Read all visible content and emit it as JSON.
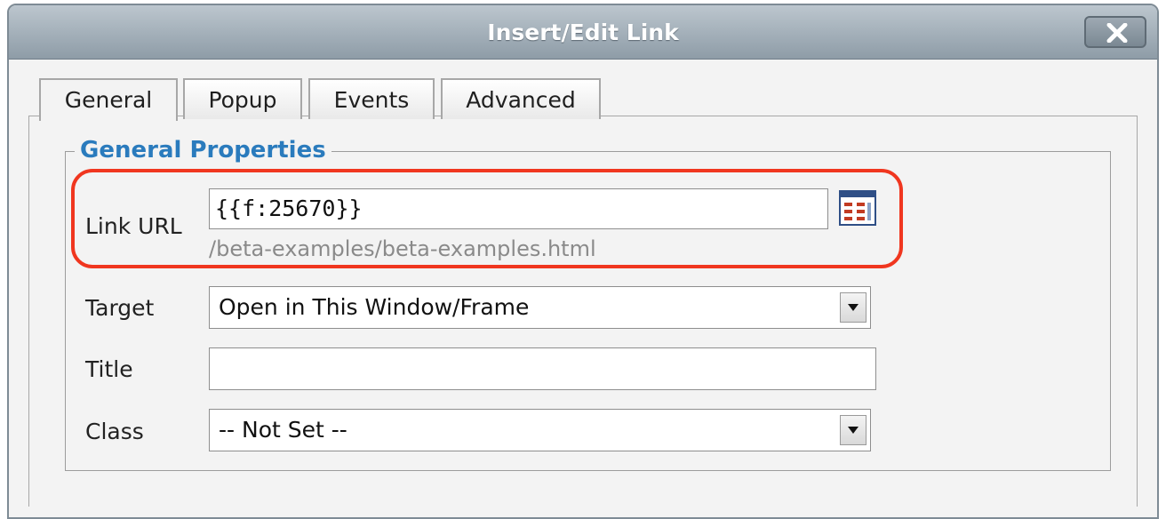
{
  "dialog": {
    "title": "Insert/Edit Link"
  },
  "tabs": [
    {
      "label": "General",
      "active": true
    },
    {
      "label": "Popup",
      "active": false
    },
    {
      "label": "Events",
      "active": false
    },
    {
      "label": "Advanced",
      "active": false
    }
  ],
  "general_properties": {
    "legend": "General Properties",
    "link_url": {
      "label": "Link URL",
      "value": "{{f:25670}}",
      "resolved_path": "/beta-examples/beta-examples.html"
    },
    "target": {
      "label": "Target",
      "selected": "Open in This Window/Frame"
    },
    "title": {
      "label": "Title",
      "value": ""
    },
    "class": {
      "label": "Class",
      "selected": "-- Not Set --"
    }
  },
  "colors": {
    "highlight": "#f0361f",
    "legend": "#2a7bbd",
    "titlebar": "#8e9ca7"
  },
  "icons": {
    "close": "close-icon",
    "browse": "browse-icon",
    "dropdown": "chevron-down-icon"
  }
}
